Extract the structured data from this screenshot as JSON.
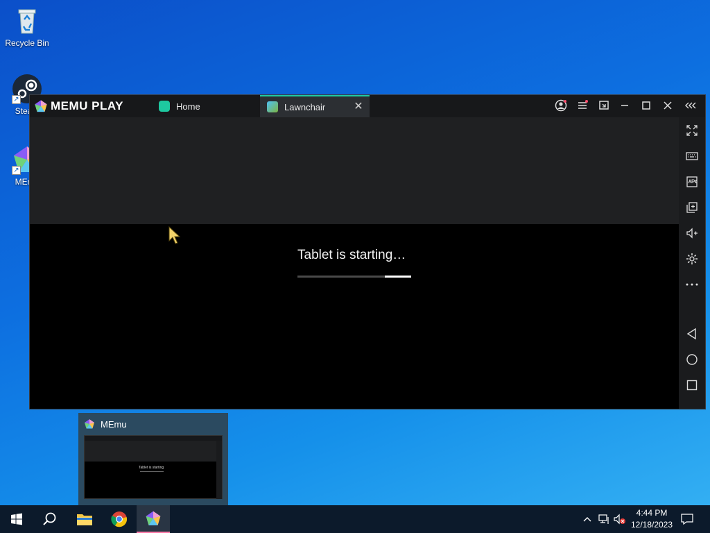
{
  "desktop": {
    "icons": [
      {
        "label": "Recycle Bin"
      },
      {
        "label": "Steam"
      },
      {
        "label": "MEmu"
      }
    ]
  },
  "window": {
    "brand": "MEMU PLAY",
    "tabs": [
      {
        "label": "Home",
        "icon": "home-app-icon"
      },
      {
        "label": "Lawnchair",
        "icon": "lawnchair-app-icon"
      }
    ],
    "boot_text": "Tablet is starting…",
    "boot_progress": 0.77,
    "title_controls": [
      "account-icon",
      "menu-icon",
      "screen-icon",
      "minimize-icon",
      "maximize-icon",
      "close-icon",
      "collapse-sidebar-icon"
    ],
    "sidebar": [
      "fullscreen-icon",
      "keyboard-icon",
      "apk-icon",
      "multi-instance-icon",
      "volume-up-icon",
      "settings-icon",
      "more-icon",
      "back-icon",
      "home-icon",
      "recents-icon"
    ]
  },
  "preview": {
    "title": "MEmu",
    "thumb_text": "Tablet is starting"
  },
  "taskbar": {
    "time": "4:44 PM",
    "date": "12/18/2023"
  },
  "colors": {
    "accent_tab": "#20c9a0",
    "taskbar_active": "#ff7aa8"
  }
}
